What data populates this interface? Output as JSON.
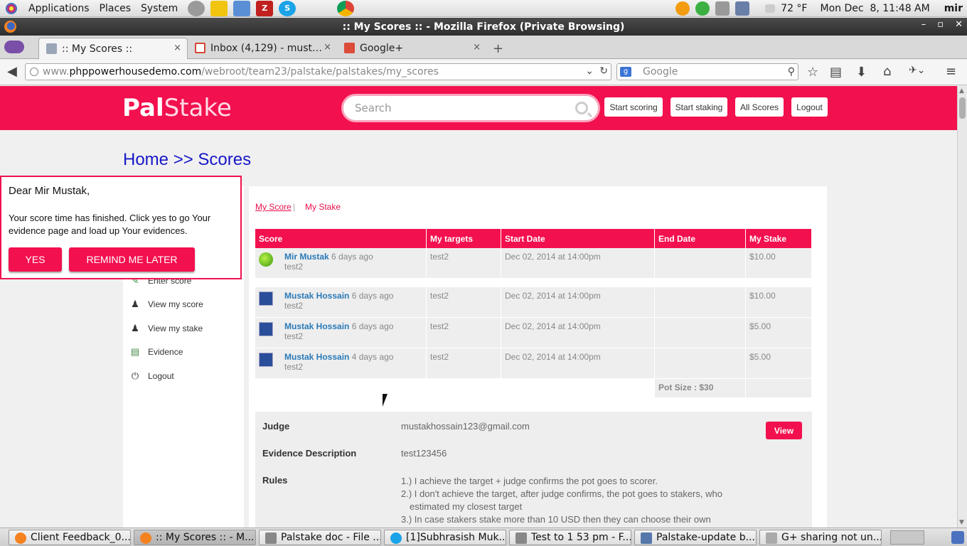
{
  "panel": {
    "menus": [
      "Applications",
      "Places",
      "System"
    ],
    "weather": "72 °F",
    "clock": "Mon Dec  8, 11:48 AM",
    "user": "mir"
  },
  "window": {
    "title": ":: My Scores :: - Mozilla Firefox (Private Browsing)"
  },
  "browser": {
    "tabs": [
      {
        "label": ":: My Scores ::",
        "close": "×"
      },
      {
        "label": "Inbox (4,129) - must…",
        "close": "×"
      },
      {
        "label": "Google+",
        "close": "×"
      }
    ],
    "new_tab": "+",
    "url_prefix": "www.",
    "url_domain": "phppowerhousedemo.com",
    "url_path": "/webroot/team23/palstake/palstakes/my_scores",
    "search_placeholder": "Google"
  },
  "site": {
    "logo_bold": "Pal",
    "logo_light": "Stake",
    "search_placeholder": "Search",
    "nav": [
      "Start scoring",
      "Start staking",
      "All Scores",
      "Logout"
    ],
    "breadcrumb": "Home >> Scores"
  },
  "sidebar": {
    "items": [
      "Enter score",
      "View my score",
      "View my stake",
      "Evidence",
      "Logout"
    ]
  },
  "subtabs": {
    "my_score": "My Score",
    "sep": "|",
    "my_stake": "My Stake"
  },
  "table": {
    "headers": [
      "Score",
      "My targets",
      "Start Date",
      "End Date",
      "My Stake"
    ],
    "rows": [
      {
        "name": "Mir Mustak",
        "ago": "6 days ago",
        "sub": "test2",
        "target": "test2",
        "start": "Dec 02, 2014 at 14:00pm",
        "end": "",
        "stake": "$10.00"
      },
      {
        "name": "Mustak Hossain",
        "ago": "6 days ago",
        "sub": "test2",
        "target": "test2",
        "start": "Dec 02, 2014 at 14:00pm",
        "end": "",
        "stake": "$10.00"
      },
      {
        "name": "Mustak Hossain",
        "ago": "6 days ago",
        "sub": "test2",
        "target": "test2",
        "start": "Dec 02, 2014 at 14:00pm",
        "end": "",
        "stake": "$5.00"
      },
      {
        "name": "Mustak Hossain",
        "ago": "4 days ago",
        "sub": "test2",
        "target": "test2",
        "start": "Dec 02, 2014 at 14:00pm",
        "end": "",
        "stake": "$5.00"
      }
    ],
    "pot_size": "Pot Size : $30"
  },
  "details": {
    "judge_label": "Judge",
    "judge_value": "mustakhossain123@gmail.com",
    "view_button": "View",
    "evidence_label": "Evidence Description",
    "evidence_value": "test123456",
    "rules_label": "Rules",
    "rules": [
      "1.) I achieve the target + judge confirms the pot goes to scorer.",
      "2.) I don't achieve the target, after judge confirms, the pot goes to stakers, who",
      "   estimated my closest target",
      "3.) In case stakers stake more than 10 USD then they can choose their own"
    ]
  },
  "popup": {
    "greeting": "Dear Mir Mustak,",
    "message": "Your score time has finished. Click yes to go Your evidence page and load up Your evidences.",
    "yes": "YES",
    "later": "REMIND ME LATER"
  },
  "taskbar": {
    "items": [
      "Client Feedback_0...",
      ":: My Scores :: - M...",
      "Palstake doc - File ...",
      "[1]Subhrasish Muk...",
      "Test to 1 53 pm - F...",
      "Palstake-update b...",
      "G+ sharing not un..."
    ]
  },
  "colors": {
    "brand": "#f3104f",
    "link": "#2a7ab8",
    "crumb": "#1818c8"
  }
}
